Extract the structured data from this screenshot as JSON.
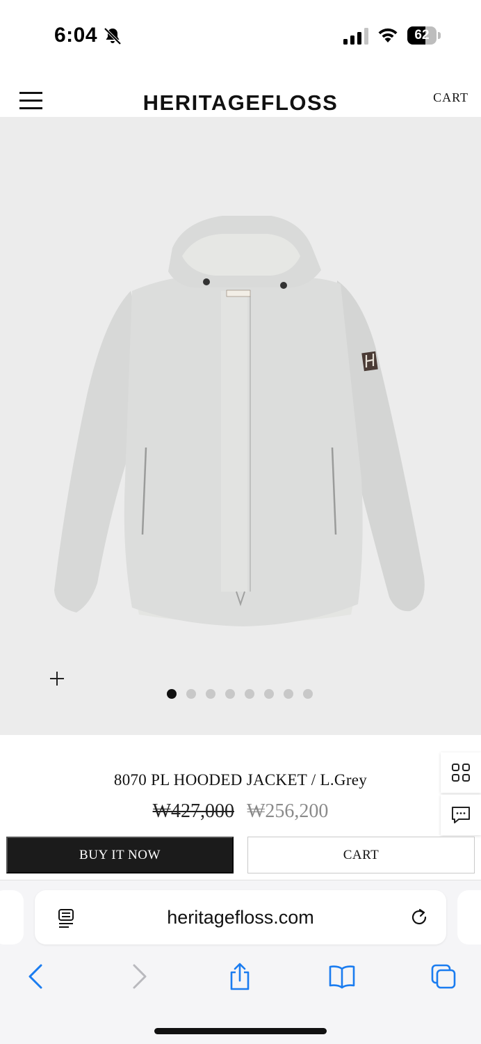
{
  "status_bar": {
    "time": "6:04",
    "battery_level": "62",
    "battery_fraction": 0.62,
    "icons": [
      "bell-slash-icon",
      "cellular-signal-icon",
      "wifi-icon",
      "battery-icon"
    ]
  },
  "header": {
    "logo": "HERITAGEFLOSS",
    "cart_label": "CART",
    "menu_icon": "hamburger-menu-icon"
  },
  "gallery": {
    "image_count": 8,
    "active_index": 0,
    "zoom_icon": "plus-icon"
  },
  "product": {
    "title": "8070 PL HOODED JACKET / L.Grey",
    "price_original": "₩427,000",
    "price_sale": "₩256,200"
  },
  "side_buttons": {
    "icons": [
      "grid-icon",
      "chat-bubble-icon"
    ]
  },
  "actions": {
    "buy_now_label": "BUY IT NOW",
    "cart_label": "CART"
  },
  "browser": {
    "url": "heritagefloss.com",
    "icons": [
      "reader-icon",
      "reload-icon",
      "back-icon",
      "forward-icon",
      "share-icon",
      "bookmarks-icon",
      "tabs-icon"
    ]
  },
  "colors": {
    "buy_button": "#1b1b1b",
    "image_background": "#ececec",
    "sale_price": "#8a8a8a",
    "browser_accent": "#1a7cf0"
  }
}
